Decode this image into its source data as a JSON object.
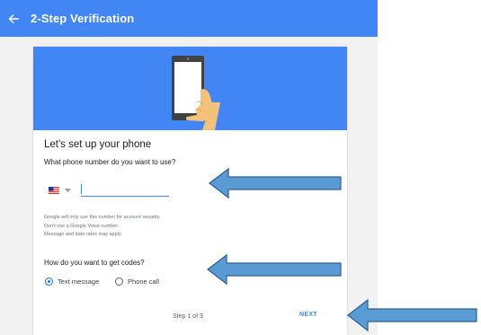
{
  "appbar": {
    "title": "2-Step Verification",
    "back_icon": "arrow-left-icon",
    "color": "#4285f4"
  },
  "hero": {
    "illustration": "hand-holding-phone",
    "color": "#4285f4"
  },
  "card": {
    "title": "Let's set up your phone",
    "phone_question": "What phone number do you want to use?",
    "country_flag": "us-flag-icon",
    "phone_value": "",
    "info_lines": [
      "Google will only use this number for account security.",
      "Don't use a Google Voice number.",
      "Message and data rates may apply."
    ],
    "codes_question": "How do you want to get codes?",
    "options": [
      {
        "label": "Text message",
        "selected": true
      },
      {
        "label": "Phone call",
        "selected": false
      }
    ],
    "step_text": "Step 1 of 3",
    "next_label": "NEXT"
  },
  "annotations": {
    "arrow_color": "#5b9bd5",
    "arrow_count": 3,
    "direction": "left"
  }
}
